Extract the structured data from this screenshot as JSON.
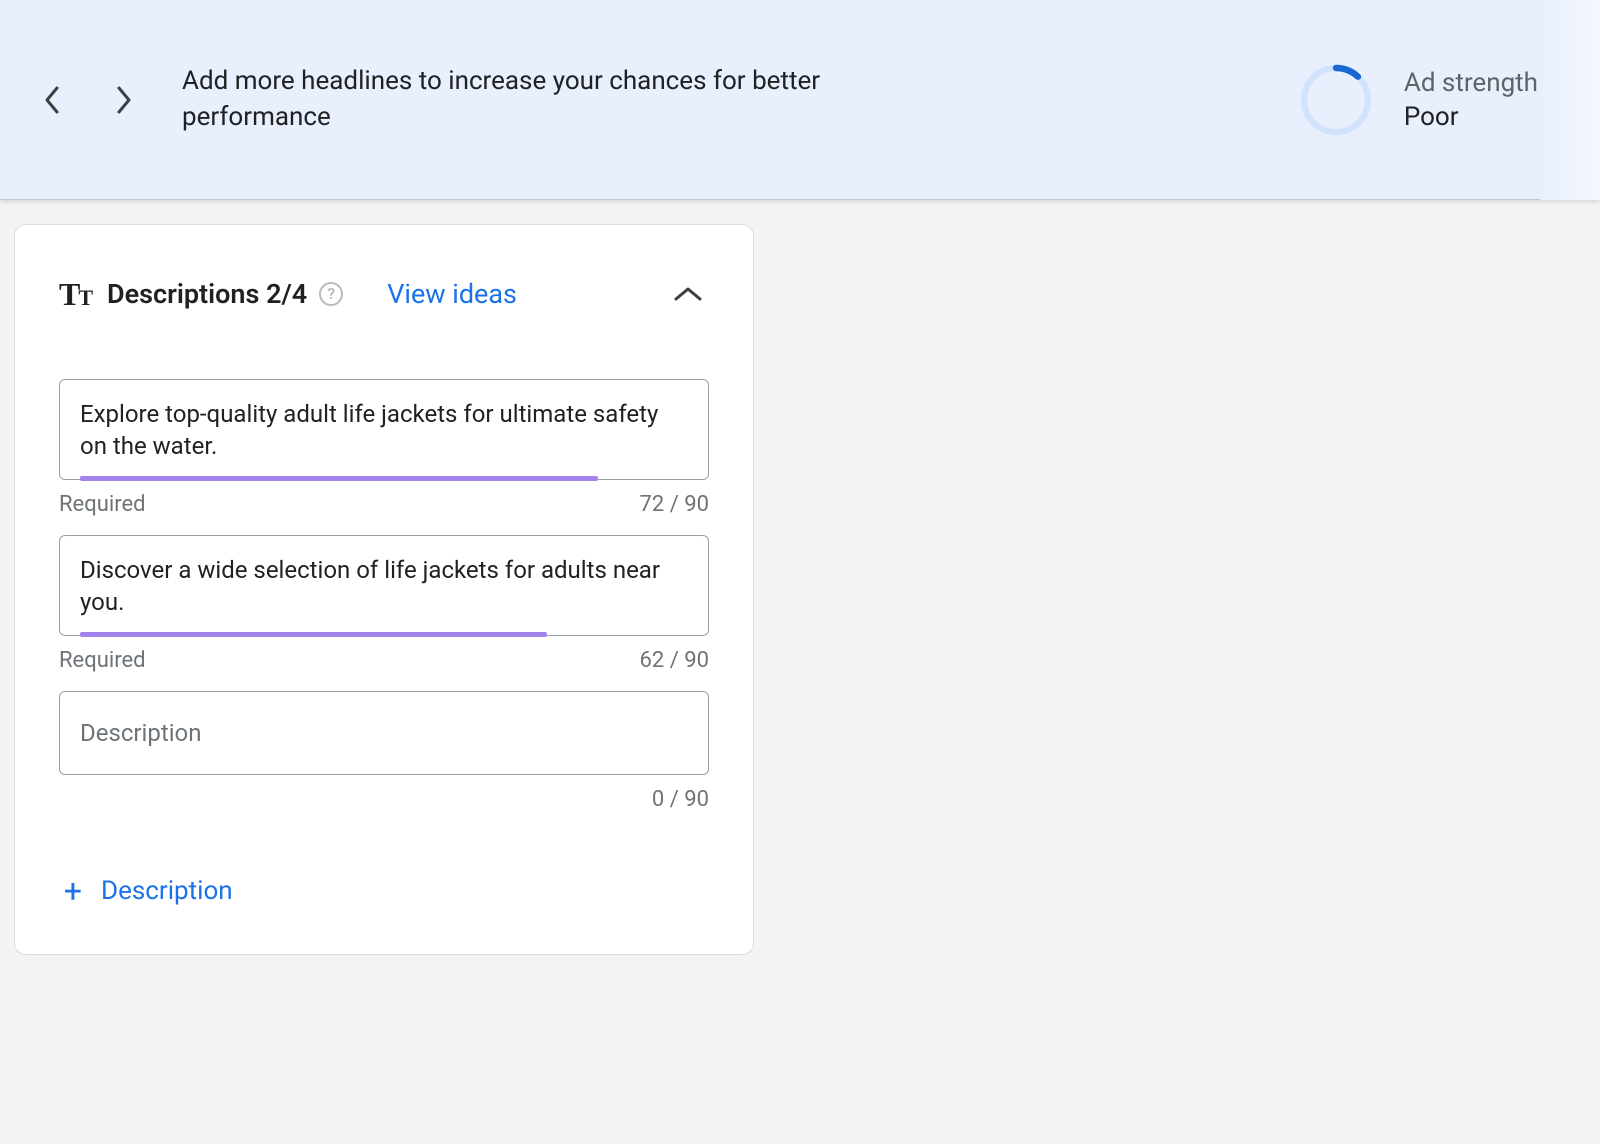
{
  "banner": {
    "message": "Add more headlines to increase your chances for better performance",
    "strength_label": "Ad strength",
    "strength_value": "Poor",
    "strength_pct": 12
  },
  "card": {
    "title": "Descriptions 2/4",
    "view_ideas": "View ideas"
  },
  "descriptions": {
    "max": 90,
    "required_label": "Required",
    "placeholder": "Description",
    "add_label": "Description",
    "items": [
      {
        "text": "Explore top-quality adult life jackets for ultimate safety on the water.",
        "count": "72 / 90",
        "required": true,
        "progress_pct": 80
      },
      {
        "text": "Discover a wide selection of life jackets for adults near you.",
        "count": "62 / 90",
        "required": true,
        "progress_pct": 72
      },
      {
        "text": "",
        "count": "0 / 90",
        "required": false,
        "progress_pct": 0
      }
    ]
  }
}
